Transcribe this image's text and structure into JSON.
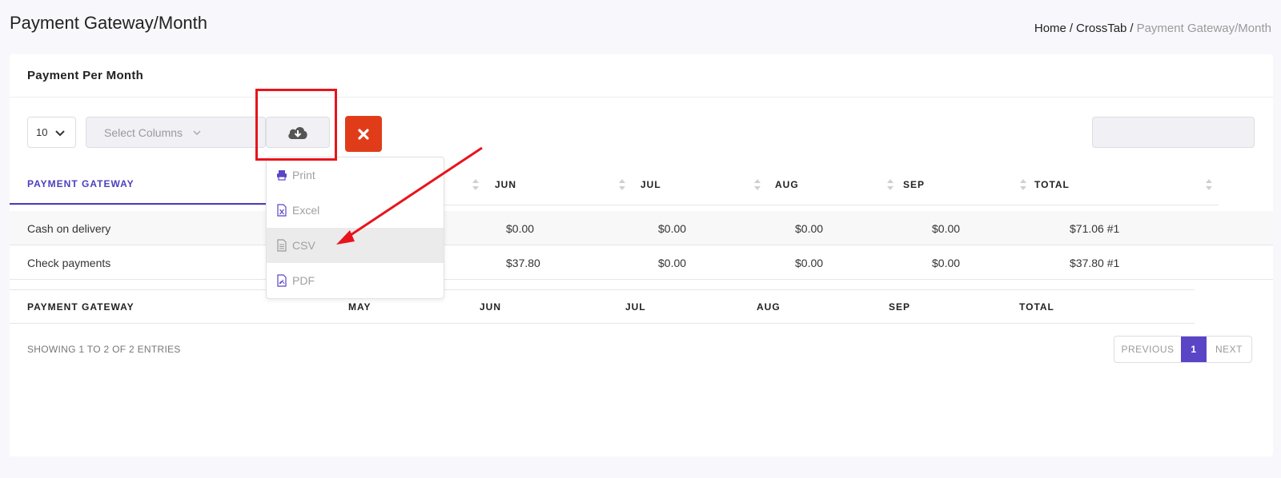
{
  "page": {
    "title": "Payment Gateway/Month",
    "breadcrumb": [
      "Home",
      "CrossTab",
      "Payment Gateway/Month"
    ]
  },
  "card": {
    "title": "Payment Per Month",
    "page_length": "10",
    "select_columns_placeholder": "Select Columns"
  },
  "table": {
    "headers": [
      "PAYMENT GATEWAY",
      "MAY",
      "JUN",
      "JUL",
      "AUG",
      "SEP",
      "TOTAL"
    ],
    "rows": [
      {
        "gateway": "Cash on delivery",
        "jun": "$0.00",
        "jul": "$0.00",
        "aug": "$0.00",
        "sep": "$0.00",
        "total": "$71.06 #1"
      },
      {
        "gateway": "Check payments",
        "jun": "$37.80",
        "jul": "$0.00",
        "aug": "$0.00",
        "sep": "$0.00",
        "total": "$37.80 #1"
      }
    ],
    "footer": [
      "PAYMENT GATEWAY",
      "MAY",
      "JUN",
      "JUL",
      "AUG",
      "SEP",
      "TOTAL"
    ],
    "info": "SHOWING 1 TO 2 OF 2 ENTRIES"
  },
  "pagination": {
    "previous": "PREVIOUS",
    "current": "1",
    "next": "NEXT"
  },
  "export_menu": {
    "items": [
      "Print",
      "Excel",
      "CSV",
      "PDF"
    ],
    "hovered": "CSV"
  },
  "colors": {
    "accent": "#5a45c6",
    "danger": "#e03c1a",
    "annotation": "#e8141c"
  },
  "icons": {
    "export": "cloud-download-icon",
    "clear": "times-icon",
    "print": "print-icon",
    "excel": "excel-file-icon",
    "csv": "csv-file-icon",
    "pdf": "pdf-file-icon"
  }
}
